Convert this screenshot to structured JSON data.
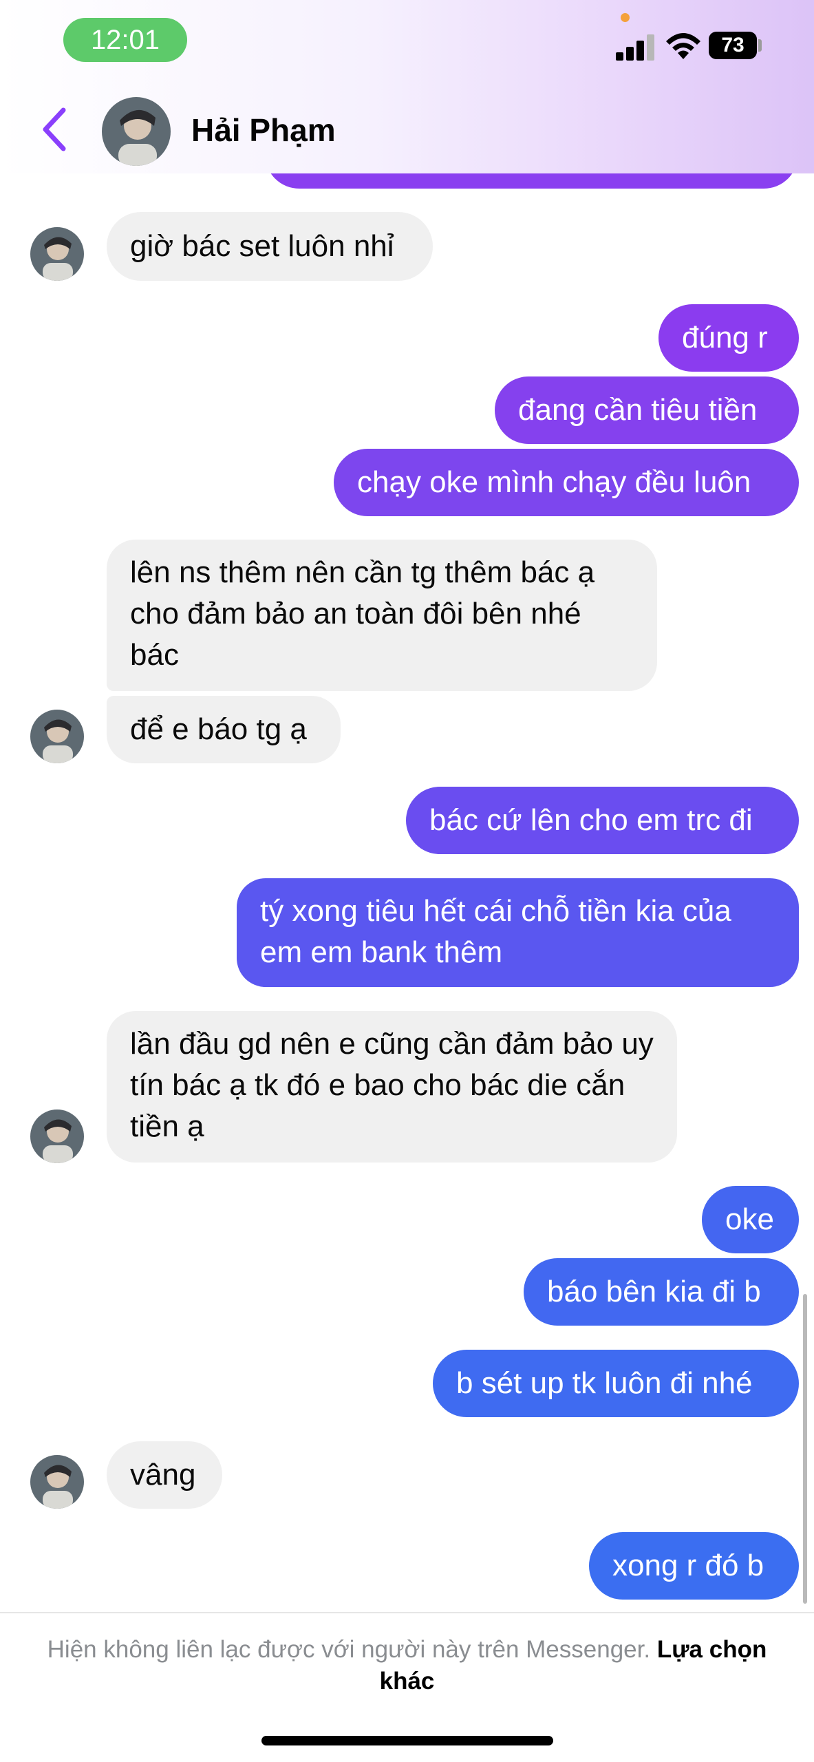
{
  "status_bar": {
    "time": "12:01",
    "battery": "73"
  },
  "header": {
    "contact_name": "Hải Phạm"
  },
  "messages": [
    {
      "text": "giờ bác set luôn nhỉ"
    },
    {
      "text": "đúng r"
    },
    {
      "text": "đang cần tiêu tiền"
    },
    {
      "text": "chạy oke mình chạy đều luôn"
    },
    {
      "text": "lên ns thêm nên cần tg thêm bác ạ cho đảm bảo an toàn đôi bên nhé bác"
    },
    {
      "text": "để e báo tg ạ"
    },
    {
      "text": "bác cứ lên cho em trc đi"
    },
    {
      "text": "tý xong tiêu hết cái chỗ tiền kia của em em bank thêm"
    },
    {
      "text": "lần đầu gd nên e cũng cần đảm bảo uy tín bác ạ tk đó e bao cho bác die cắn tiền ạ"
    },
    {
      "text": "oke"
    },
    {
      "text": "báo bên kia đi b"
    },
    {
      "text": "b sét up tk luôn đi nhé"
    },
    {
      "text": "vâng"
    },
    {
      "text": "xong r đó b"
    }
  ],
  "footer": {
    "notice": "Hiện không liên lạc được với người này trên Messenger.",
    "link": "Lựa chọn khác"
  },
  "colors": {
    "outgoing_top": "#7c3fec",
    "outgoing_bottom": "#3b6cf1",
    "incoming": "#f0f0f0",
    "accent": "#8a3ffc"
  }
}
